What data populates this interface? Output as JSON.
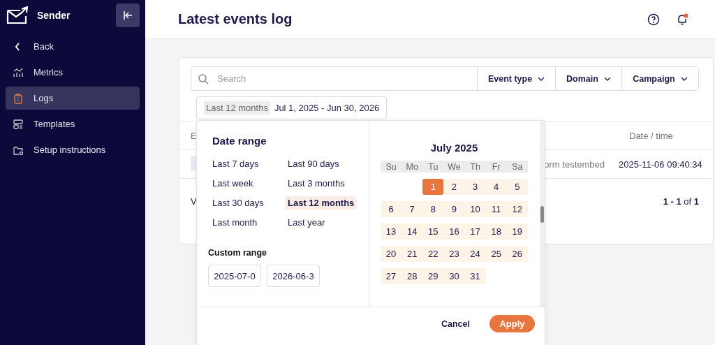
{
  "sidebar": {
    "brand": "Sender",
    "items": [
      {
        "label": "Back",
        "kind": "back",
        "selected": false
      },
      {
        "label": "Metrics",
        "kind": "metrics",
        "selected": false
      },
      {
        "label": "Logs",
        "kind": "logs",
        "selected": true
      },
      {
        "label": "Templates",
        "kind": "templates",
        "selected": false
      },
      {
        "label": "Setup instructions",
        "kind": "setup",
        "selected": false
      }
    ]
  },
  "header": {
    "title": "Latest events log",
    "notification": true
  },
  "filters": {
    "search_placeholder": "Search",
    "dropdowns": [
      "Event type",
      "Domain",
      "Campaign"
    ],
    "date_chip": {
      "preset": "Last 12 months",
      "range": "Jul 1, 2025 - Jun 30, 2026"
    }
  },
  "table": {
    "columns": [
      "E",
      "Date / time"
    ],
    "rows": [
      {
        "column_2": "orm testembed",
        "date": "2025-11-06 09:40:34"
      }
    ],
    "footer_left": "V",
    "pagination": {
      "range": "1 - 1",
      "of": "of",
      "total": "1"
    }
  },
  "date_popup": {
    "title": "Date range",
    "presets": [
      {
        "label": "Last 7 days",
        "selected": false
      },
      {
        "label": "Last 90 days",
        "selected": false
      },
      {
        "label": "Last week",
        "selected": false
      },
      {
        "label": "Last 3 months",
        "selected": false
      },
      {
        "label": "Last 30 days",
        "selected": false
      },
      {
        "label": "Last 12 months",
        "selected": true
      },
      {
        "label": "Last month",
        "selected": false
      },
      {
        "label": "Last year",
        "selected": false
      }
    ],
    "custom_title": "Custom range",
    "start": "2025-07-0",
    "end": "2026-06-3",
    "calendar": {
      "month": "July 2025",
      "weekdays": [
        "Su",
        "Mo",
        "Tu",
        "We",
        "Th",
        "Fr",
        "Sa"
      ],
      "weeks": [
        [
          {
            "kind": "blank"
          },
          {
            "kind": "blank"
          },
          {
            "kind": "day",
            "day": "1",
            "selected": true,
            "in_range": true
          },
          {
            "kind": "day",
            "day": "2",
            "selected": false,
            "in_range": true
          },
          {
            "kind": "day",
            "day": "3",
            "selected": false,
            "in_range": true
          },
          {
            "kind": "day",
            "day": "4",
            "selected": false,
            "in_range": true
          },
          {
            "kind": "day",
            "day": "5",
            "selected": false,
            "in_range": true
          }
        ],
        [
          {
            "kind": "day",
            "day": "6",
            "selected": false,
            "in_range": true
          },
          {
            "kind": "day",
            "day": "7",
            "selected": false,
            "in_range": true
          },
          {
            "kind": "day",
            "day": "8",
            "selected": false,
            "in_range": true
          },
          {
            "kind": "day",
            "day": "9",
            "selected": false,
            "in_range": true
          },
          {
            "kind": "day",
            "day": "10",
            "selected": false,
            "in_range": true
          },
          {
            "kind": "day",
            "day": "11",
            "selected": false,
            "in_range": true
          },
          {
            "kind": "day",
            "day": "12",
            "selected": false,
            "in_range": true
          }
        ],
        [
          {
            "kind": "day",
            "day": "13",
            "selected": false,
            "in_range": true
          },
          {
            "kind": "day",
            "day": "14",
            "selected": false,
            "in_range": true
          },
          {
            "kind": "day",
            "day": "15",
            "selected": false,
            "in_range": true
          },
          {
            "kind": "day",
            "day": "16",
            "selected": false,
            "in_range": true
          },
          {
            "kind": "day",
            "day": "17",
            "selected": false,
            "in_range": true
          },
          {
            "kind": "day",
            "day": "18",
            "selected": false,
            "in_range": true
          },
          {
            "kind": "day",
            "day": "19",
            "selected": false,
            "in_range": true
          }
        ],
        [
          {
            "kind": "day",
            "day": "20",
            "selected": false,
            "in_range": true
          },
          {
            "kind": "day",
            "day": "21",
            "selected": false,
            "in_range": true
          },
          {
            "kind": "day",
            "day": "22",
            "selected": false,
            "in_range": true
          },
          {
            "kind": "day",
            "day": "23",
            "selected": false,
            "in_range": true
          },
          {
            "kind": "day",
            "day": "24",
            "selected": false,
            "in_range": true
          },
          {
            "kind": "day",
            "day": "25",
            "selected": false,
            "in_range": true
          },
          {
            "kind": "day",
            "day": "26",
            "selected": false,
            "in_range": true
          }
        ],
        [
          {
            "kind": "day",
            "day": "27",
            "selected": false,
            "in_range": true
          },
          {
            "kind": "day",
            "day": "28",
            "selected": false,
            "in_range": true
          },
          {
            "kind": "day",
            "day": "29",
            "selected": false,
            "in_range": true
          },
          {
            "kind": "day",
            "day": "30",
            "selected": false,
            "in_range": true
          },
          {
            "kind": "day",
            "day": "31",
            "selected": false,
            "in_range": true
          }
        ]
      ]
    },
    "buttons": {
      "cancel": "Cancel",
      "apply": "Apply"
    }
  }
}
